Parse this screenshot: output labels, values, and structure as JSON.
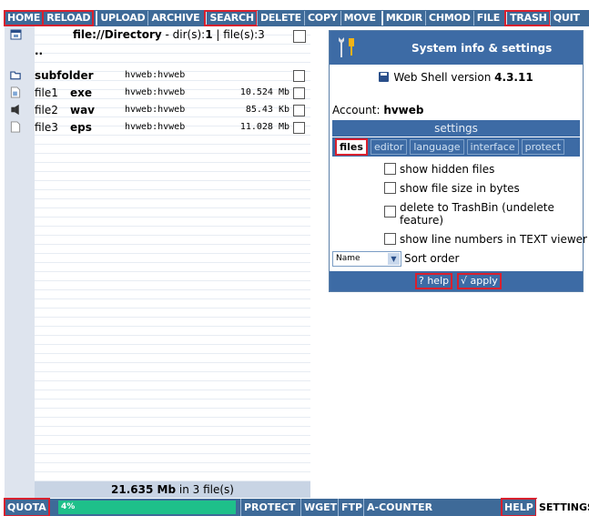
{
  "toolbar": {
    "home": "HOME",
    "reload": "RELOAD",
    "upload": "UPLOAD",
    "archive": "ARCHIVE",
    "search": "SEARCH",
    "delete": "DELETE",
    "copy": "COPY",
    "move": "MOVE",
    "mkdir": "MKDIR",
    "chmod": "CHMOD",
    "file": "FILE",
    "trash": "TRASH",
    "quit": "QUIT"
  },
  "files": {
    "header_prefix": "file://",
    "header_dir": "Directory",
    "header_mid": " - dir(s):",
    "dir_count": "1",
    "header_files": " | file(s):3",
    "parent": "..",
    "rows": [
      {
        "name": "subfolder",
        "ext": "",
        "owner": "hvweb:hvweb",
        "size": ""
      },
      {
        "name": "file1",
        "ext": "exe",
        "owner": "hvweb:hvweb",
        "size": "10.524 Mb"
      },
      {
        "name": "file2",
        "ext": "wav",
        "owner": "hvweb:hvweb",
        "size": "85.43 Kb"
      },
      {
        "name": "file3",
        "ext": "eps",
        "owner": "hvweb:hvweb",
        "size": "11.028 Mb"
      }
    ],
    "footer_size": "21.635 Mb",
    "footer_rest": " in 3 file(s)"
  },
  "dialog": {
    "title": "System info & settings",
    "version_label": "Web Shell version ",
    "version": "4.3.11",
    "account_label": "Account: ",
    "account": "hvweb",
    "settings_label": "settings",
    "tabs": [
      "files",
      "editor",
      "language",
      "interface",
      "protect"
    ],
    "options": [
      "show hidden files",
      "show file size in bytes",
      "delete to TrashBin (undelete",
      "feature)",
      "show line numbers in TEXT viewer"
    ],
    "sort_value": "Name",
    "sort_label": "Sort order",
    "help": "? help",
    "apply": "√ apply"
  },
  "bottom": {
    "quota": "QUOTA",
    "quota_pct": "4%",
    "protect": "PROTECT",
    "wget": "WGET",
    "ftp": "FTP",
    "acounter": "A-COUNTER",
    "help": "HELP",
    "settings": "SETTINGS"
  },
  "colors": {
    "bar": "#3e6a98",
    "panel": "#3d6ba5",
    "highlight": "#d8202e",
    "quota": "#1ec08a"
  }
}
